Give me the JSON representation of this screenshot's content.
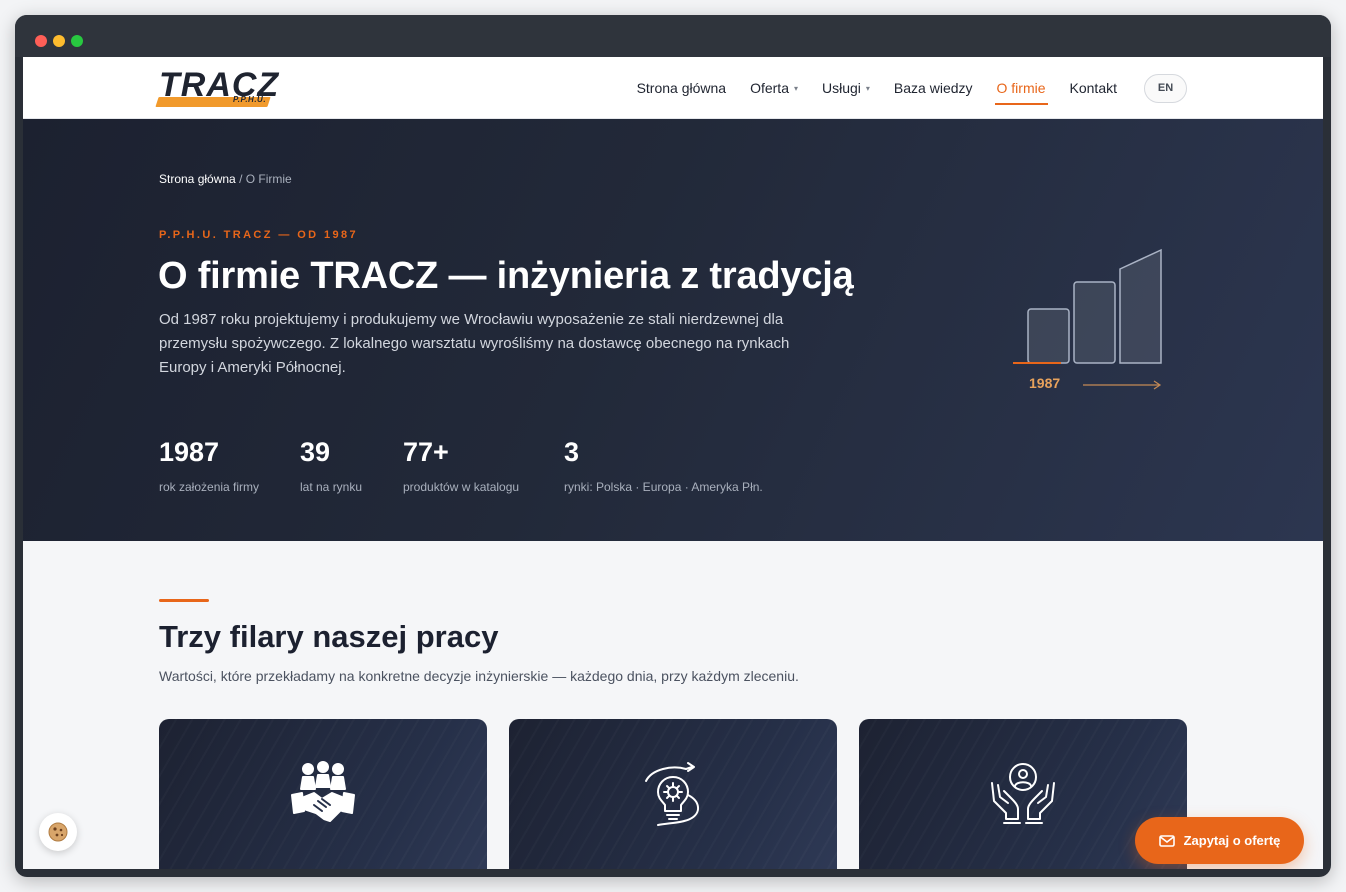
{
  "logo": {
    "word": "TRACZ",
    "sub": "P.P.H.U."
  },
  "nav": {
    "items": [
      {
        "label": "Strona główna",
        "caret": false,
        "active": false
      },
      {
        "label": "Oferta",
        "caret": true,
        "active": false
      },
      {
        "label": "Usługi",
        "caret": true,
        "active": false
      },
      {
        "label": "Baza wiedzy",
        "caret": false,
        "active": false
      },
      {
        "label": "O firmie",
        "caret": false,
        "active": true
      },
      {
        "label": "Kontakt",
        "caret": false,
        "active": false
      }
    ],
    "lang": "EN",
    "caret_glyph": "▾"
  },
  "hero": {
    "breadcrumb": {
      "home": "Strona główna",
      "separator": "/",
      "current": "O Firmie"
    },
    "kicker": "P.P.H.U. TRACZ — OD 1987",
    "title": "O firmie TRACZ — inżynieria z tradycją",
    "description": "Od 1987 roku projektujemy i produkujemy we Wrocławiu wyposażenie ze stali nierdzewnej dla przemysłu spożywczego. Z lokalnego warsztatu wyrośliśmy na dostawcę obecnego na rynkach Europy i Ameryki Północnej.",
    "stats": [
      {
        "value": "1987",
        "label": "rok założenia firmy"
      },
      {
        "value": "39",
        "label": "lat na rynku"
      },
      {
        "value": "77+",
        "label": "produktów w katalogu"
      },
      {
        "value": "3",
        "label": "rynki: Polska · Europa · Ameryka Płn."
      }
    ],
    "graphic_year": "1987"
  },
  "section": {
    "title": "Trzy filary naszej pracy",
    "subtitle": "Wartości, które przekładamy na konkretne decyzje inżynierskie — każdego dnia, przy każdym zleceniu.",
    "cards": [
      {
        "icon": "handshake-team-icon"
      },
      {
        "icon": "lightbulb-gear-icon"
      },
      {
        "icon": "hands-care-person-icon"
      }
    ]
  },
  "floating": {
    "cta_label": "Zapytaj o ofertę",
    "cta_icon": "envelope-icon",
    "cookie_icon": "cookie-icon"
  },
  "colors": {
    "accent": "#e8661a",
    "hero_bg": "#1c2130",
    "logo_accent": "#f19a2c"
  }
}
